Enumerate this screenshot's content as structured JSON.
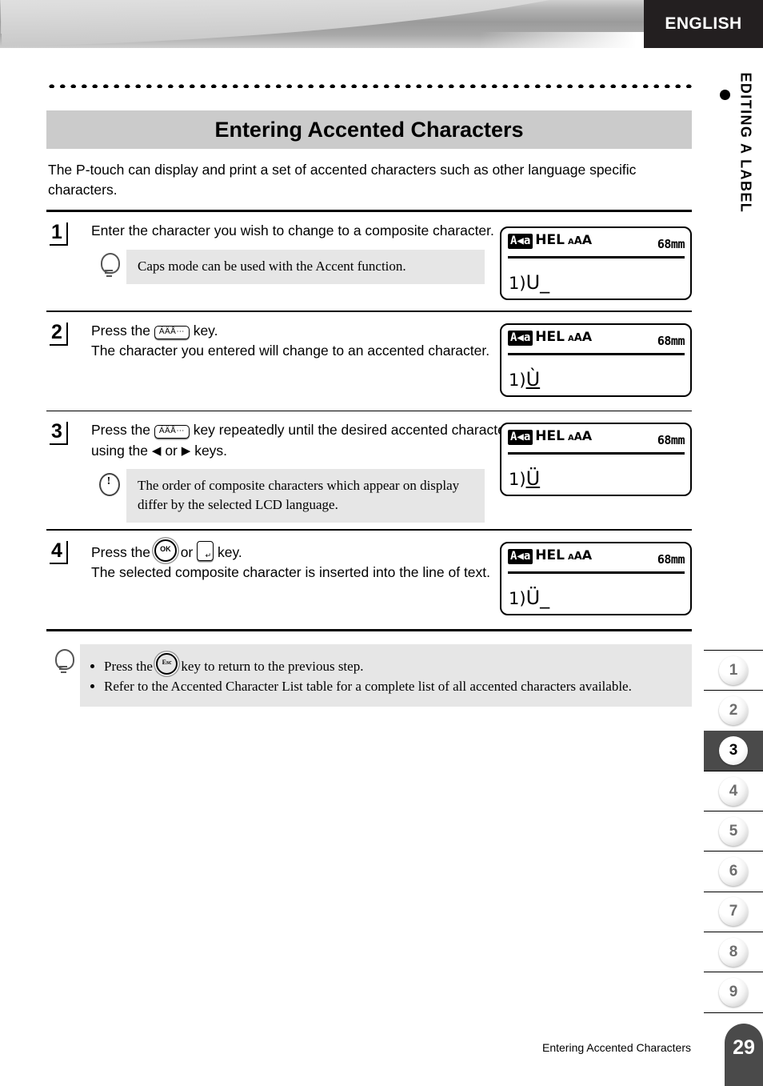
{
  "header": {
    "language_tab": "ENGLISH",
    "chapter_label": "EDITING A LABEL",
    "chapter_bullet": "bullet-dot"
  },
  "section": {
    "title": "Entering Accented Characters",
    "intro": "The P-touch can display and print a set of accented characters such as other language specific characters."
  },
  "steps": [
    {
      "number": "1",
      "text_before": "Enter the character you wish to change to a composite character.",
      "note": {
        "icon": "lightbulb-icon",
        "text": "Caps mode can be used with the Accent function."
      },
      "lcd": {
        "caps_indicator": "A◀a",
        "font_name": "HEL",
        "size_indicator": "AAA",
        "length": "68mm",
        "line_marker": "1)",
        "line_text": "U",
        "cursor": "_",
        "underlined": false
      }
    },
    {
      "number": "2",
      "text_part1": "Press the",
      "key_label": "ÁÄÅ⋯",
      "text_part2": "key.",
      "text_part3": "The character you entered will change to an accented character.",
      "lcd": {
        "caps_indicator": "A◀a",
        "font_name": "HEL",
        "size_indicator": "AAA",
        "length": "68mm",
        "line_marker": "1)",
        "line_text": "Ù",
        "cursor": "",
        "underlined": true
      }
    },
    {
      "number": "3",
      "text_part1": "Press the",
      "key_label": "ÁÄÅ⋯",
      "text_part2": "key repeatedly until the desired accented character is selected, or select it by using the",
      "arrow_left": "◀",
      "or_word": "or",
      "arrow_right": "▶",
      "text_part3": "keys.",
      "note": {
        "icon": "warning-icon",
        "text": "The order of composite characters which appear on display differ by the selected LCD language."
      },
      "lcd": {
        "caps_indicator": "A◀a",
        "font_name": "HEL",
        "size_indicator": "AAA",
        "length": "68mm",
        "line_marker": "1)",
        "line_text": "Ü",
        "cursor": "",
        "underlined": true
      }
    },
    {
      "number": "4",
      "text_part1": "Press the",
      "key_ok_label": "OK",
      "or_word": "or",
      "key_enter_label": "enter-key",
      "text_part2": "key.",
      "text_part3": "The selected composite character is inserted into the line of text.",
      "lcd": {
        "caps_indicator": "A◀a",
        "font_name": "HEL",
        "size_indicator": "AAA",
        "length": "68mm",
        "line_marker": "1)",
        "line_text": "Ü",
        "cursor": "_",
        "underlined": false
      }
    }
  ],
  "bottom_tip": {
    "icon": "lightbulb-icon",
    "bullet1_part1": "Press the",
    "bullet1_key": "Esc",
    "bullet1_part2": "key to return to the previous step.",
    "bullet2": "Refer to the Accented Character List table for a complete list of all accented characters available."
  },
  "side_rail": {
    "items": [
      "1",
      "2",
      "3",
      "4",
      "5",
      "6",
      "7",
      "8",
      "9"
    ],
    "active": "3"
  },
  "footer": {
    "text": "Entering Accented Characters",
    "page": "29"
  },
  "colors": {
    "dark": "#231f20",
    "title_bg": "#cbcbcb",
    "note_bg": "#e6e6e6",
    "rail_active": "#4a4a4a"
  }
}
